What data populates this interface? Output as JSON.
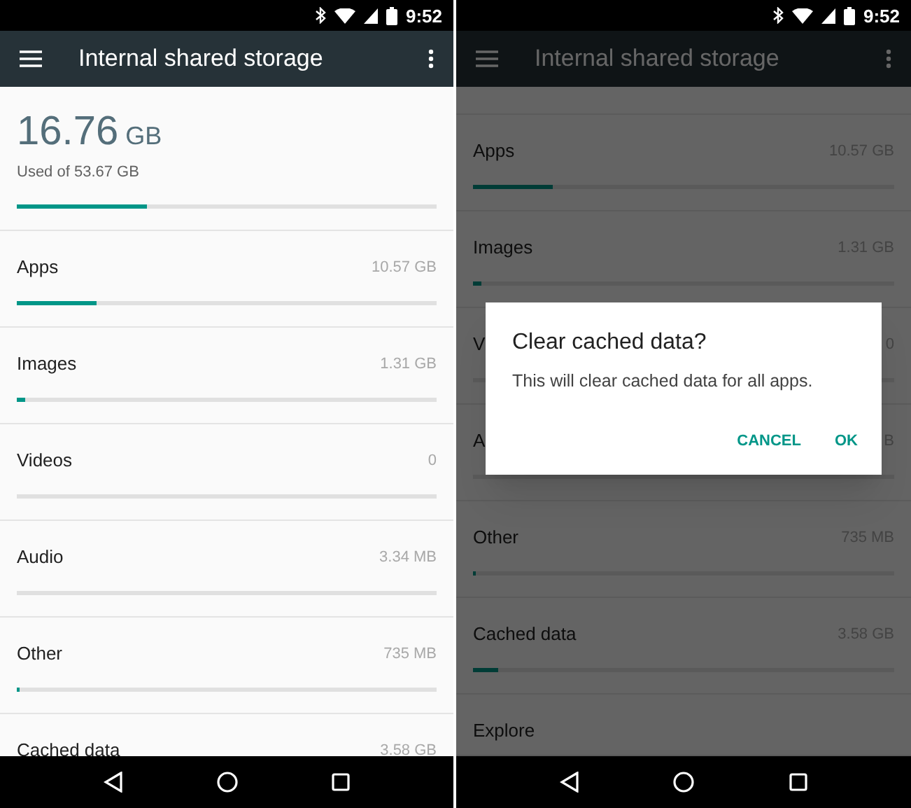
{
  "screens": [
    {
      "status_bar": {
        "time": "9:52"
      },
      "app_bar": {
        "title": "Internal shared storage"
      },
      "summary": {
        "used": "16.76",
        "unit": "GB",
        "caption": "Used of 53.67 GB",
        "level": 0.31
      },
      "categories": [
        {
          "kind": "meter",
          "label": "Apps",
          "size": "10.57 GB",
          "level": 0.19
        },
        {
          "kind": "meter",
          "label": "Images",
          "size": "1.31 GB",
          "level": 0.02
        },
        {
          "kind": "meter",
          "label": "Videos",
          "size": "0"
        },
        {
          "kind": "meter",
          "label": "Audio",
          "size": "3.34 MB"
        },
        {
          "kind": "meter",
          "label": "Other",
          "size": "735 MB",
          "level": 0.006
        },
        {
          "kind": "plain",
          "label": "Cached data",
          "size": "3.58 GB"
        }
      ]
    },
    {
      "status_bar": {
        "time": "9:52"
      },
      "app_bar": {
        "title": "Internal shared storage"
      },
      "categories": [
        {
          "kind": "meter",
          "label": "Apps",
          "size": "10.57 GB",
          "level": 0.19
        },
        {
          "kind": "meter",
          "label": "Images",
          "size": "1.31 GB",
          "level": 0.02
        },
        {
          "kind": "meter",
          "label": "V",
          "size": "0"
        },
        {
          "kind": "meter",
          "label": "A",
          "size": "B"
        },
        {
          "kind": "meter",
          "label": "Other",
          "size": "735 MB",
          "level": 0.006
        },
        {
          "kind": "meter",
          "label": "Cached data",
          "size": "3.58 GB",
          "level": 0.06
        },
        {
          "kind": "plain",
          "label": "Explore"
        }
      ],
      "dialog": {
        "title": "Clear cached data?",
        "message": "This will clear cached data for all apps.",
        "buttons": [
          "CANCEL",
          "OK"
        ]
      }
    }
  ]
}
